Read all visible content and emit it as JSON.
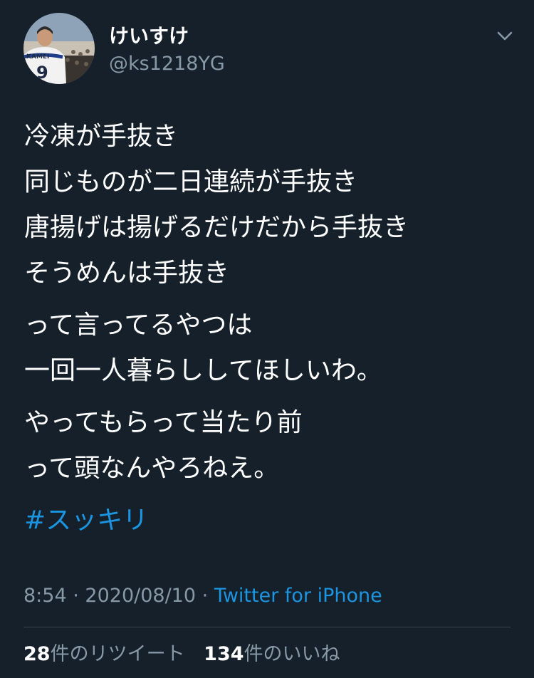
{
  "user": {
    "display_name": "けいすけ",
    "handle": "@ks1218YG"
  },
  "tweet": {
    "paragraphs": [
      [
        "冷凍が手抜き",
        "同じものが二日連続が手抜き",
        "唐揚げは揚げるだけだから手抜き",
        "そうめんは手抜き"
      ],
      [
        "って言ってるやつは",
        "一回一人暮らししてほしいわ。"
      ],
      [
        "やってもらって当たり前",
        "って頭なんやろねえ。"
      ]
    ],
    "hashtag": "#スッキリ"
  },
  "meta": {
    "time": "8:54",
    "separator": "·",
    "date": "2020/08/10",
    "source": "Twitter for iPhone"
  },
  "stats": {
    "retweets_count": "28",
    "retweets_label": "件のリツイート",
    "likes_count": "134",
    "likes_label": "件のいいね"
  },
  "icons": {
    "caret": "chevron-down-icon"
  },
  "colors": {
    "background": "#15202b",
    "text": "#ffffff",
    "secondary": "#8899a6",
    "link": "#1b95e0",
    "divider": "#38444d"
  }
}
